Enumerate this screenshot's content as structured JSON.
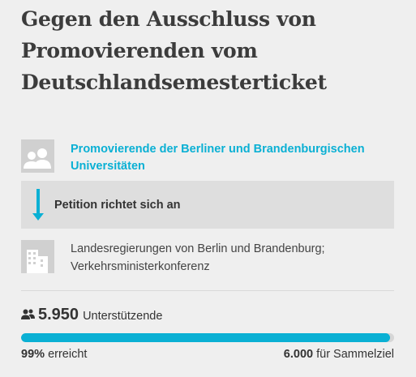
{
  "petition": {
    "title": "Gegen den Ausschluss von Promovierenden vom Deutschlandsemesterticket"
  },
  "initiator": {
    "icon": "people-icon",
    "name": "Promovierende der Berliner und Brandenburgischen Universitäten"
  },
  "recipient": {
    "icon": "arrow-down-icon",
    "label": "Petition richtet sich an"
  },
  "addressee": {
    "icon": "building-icon",
    "text_line1": "Landesregierungen von Berlin und Brandenburg;",
    "text_line2": "Verkehrsministerkonferenz"
  },
  "supporters": {
    "icon": "supporters-icon",
    "count": "5.950",
    "label": "Unterstützende"
  },
  "progress": {
    "fraction": 0.99,
    "percent_value": "99%",
    "percent_label": "erreicht",
    "goal_value": "6.000",
    "goal_label": "für Sammelziel"
  },
  "colors": {
    "accent": "#0ab0d4",
    "background": "#efefef",
    "box": "#dedede",
    "placeholder": "#d0d0d0"
  }
}
